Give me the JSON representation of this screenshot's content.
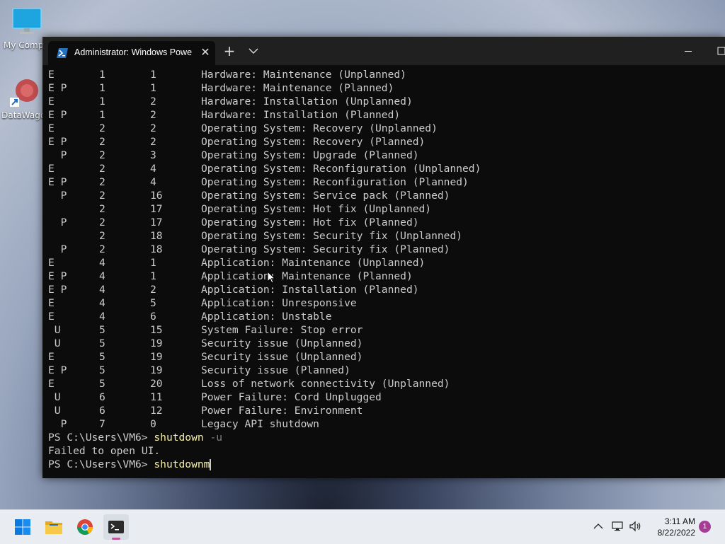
{
  "desktop": {
    "icons": [
      {
        "label": "My Compu"
      },
      {
        "label": "DataWagon"
      }
    ]
  },
  "window": {
    "tab_title": "Administrator: Windows PowerS",
    "close_tab": "✕",
    "new_tab": "+",
    "accent": "#2671be"
  },
  "console": {
    "rows": [
      {
        "flags": "E",
        "major": "1",
        "minor": "1",
        "desc": "Hardware: Maintenance (Unplanned)"
      },
      {
        "flags": "E P",
        "major": "1",
        "minor": "1",
        "desc": "Hardware: Maintenance (Planned)"
      },
      {
        "flags": "E",
        "major": "1",
        "minor": "2",
        "desc": "Hardware: Installation (Unplanned)"
      },
      {
        "flags": "E P",
        "major": "1",
        "minor": "2",
        "desc": "Hardware: Installation (Planned)"
      },
      {
        "flags": "E",
        "major": "2",
        "minor": "2",
        "desc": "Operating System: Recovery (Unplanned)"
      },
      {
        "flags": "E P",
        "major": "2",
        "minor": "2",
        "desc": "Operating System: Recovery (Planned)"
      },
      {
        "flags": "  P",
        "major": "2",
        "minor": "3",
        "desc": "Operating System: Upgrade (Planned)"
      },
      {
        "flags": "E",
        "major": "2",
        "minor": "4",
        "desc": "Operating System: Reconfiguration (Unplanned)"
      },
      {
        "flags": "E P",
        "major": "2",
        "minor": "4",
        "desc": "Operating System: Reconfiguration (Planned)"
      },
      {
        "flags": "  P",
        "major": "2",
        "minor": "16",
        "desc": "Operating System: Service pack (Planned)"
      },
      {
        "flags": "",
        "major": "2",
        "minor": "17",
        "desc": "Operating System: Hot fix (Unplanned)"
      },
      {
        "flags": "  P",
        "major": "2",
        "minor": "17",
        "desc": "Operating System: Hot fix (Planned)"
      },
      {
        "flags": "",
        "major": "2",
        "minor": "18",
        "desc": "Operating System: Security fix (Unplanned)"
      },
      {
        "flags": "  P",
        "major": "2",
        "minor": "18",
        "desc": "Operating System: Security fix (Planned)"
      },
      {
        "flags": "E",
        "major": "4",
        "minor": "1",
        "desc": "Application: Maintenance (Unplanned)"
      },
      {
        "flags": "E P",
        "major": "4",
        "minor": "1",
        "desc": "Application: Maintenance (Planned)"
      },
      {
        "flags": "E P",
        "major": "4",
        "minor": "2",
        "desc": "Application: Installation (Planned)"
      },
      {
        "flags": "E",
        "major": "4",
        "minor": "5",
        "desc": "Application: Unresponsive"
      },
      {
        "flags": "E",
        "major": "4",
        "minor": "6",
        "desc": "Application: Unstable"
      },
      {
        "flags": " U",
        "major": "5",
        "minor": "15",
        "desc": "System Failure: Stop error"
      },
      {
        "flags": " U",
        "major": "5",
        "minor": "19",
        "desc": "Security issue (Unplanned)"
      },
      {
        "flags": "E",
        "major": "5",
        "minor": "19",
        "desc": "Security issue (Unplanned)"
      },
      {
        "flags": "E P",
        "major": "5",
        "minor": "19",
        "desc": "Security issue (Planned)"
      },
      {
        "flags": "E",
        "major": "5",
        "minor": "20",
        "desc": "Loss of network connectivity (Unplanned)"
      },
      {
        "flags": " U",
        "major": "6",
        "minor": "11",
        "desc": "Power Failure: Cord Unplugged"
      },
      {
        "flags": " U",
        "major": "6",
        "minor": "12",
        "desc": "Power Failure: Environment"
      },
      {
        "flags": "  P",
        "major": "7",
        "minor": "0",
        "desc": "Legacy API shutdown"
      }
    ],
    "prompt1": "PS C:\\Users\\VM6> ",
    "cmd1": "shutdown",
    "param1": " -u",
    "error": "Failed to open UI.",
    "prompt2": "PS C:\\Users\\VM6> ",
    "cmd2": "shutdownm"
  },
  "taskbar": {
    "time": "3:11 AM",
    "date": "8/22/2022",
    "notifications": "1"
  },
  "icons": [
    "computer-icon",
    "datawagon-icon",
    "powershell-icon",
    "close-icon",
    "plus-icon",
    "chevron-down-icon",
    "minimize-icon",
    "maximize-icon",
    "windows-start-icon",
    "file-explorer-icon",
    "chrome-icon",
    "terminal-icon",
    "chevron-up-icon",
    "network-icon",
    "volume-icon"
  ]
}
